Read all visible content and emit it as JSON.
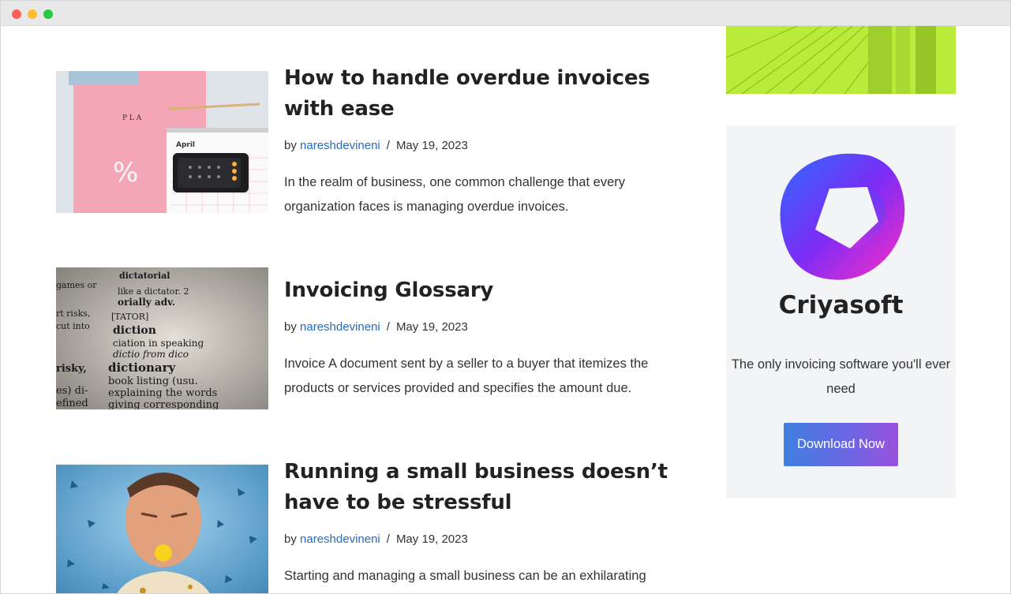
{
  "posts": [
    {
      "title": "How to handle overdue invoices with ease",
      "byline_prefix": "by",
      "author": "nareshdevineni",
      "separator": "/",
      "date": "May 19, 2023",
      "excerpt": "In the realm of business, one common challenge that every organization faces is managing overdue invoices.",
      "thumb_text": "April"
    },
    {
      "title": "Invoicing Glossary",
      "byline_prefix": "by",
      "author": "nareshdevineni",
      "separator": "/",
      "date": "May 19, 2023",
      "excerpt": "Invoice A document sent by a seller to a buyer that itemizes the products or services provided and specifies the amount due."
    },
    {
      "title": "Running a small business doesn’t have to be stressful",
      "byline_prefix": "by",
      "author": "nareshdevineni",
      "separator": "/",
      "date": "May 19, 2023",
      "excerpt": "Starting and managing a small business can be an exhilarating"
    }
  ],
  "sidebar": {
    "promo": {
      "name": "Criyasoft",
      "tagline": "The only invoicing software you'll ever need",
      "button_label": "Download Now"
    }
  },
  "colors": {
    "link": "#2a6bb8",
    "banner": "#b9ec3a",
    "promo_bg": "#f3f4f6"
  }
}
